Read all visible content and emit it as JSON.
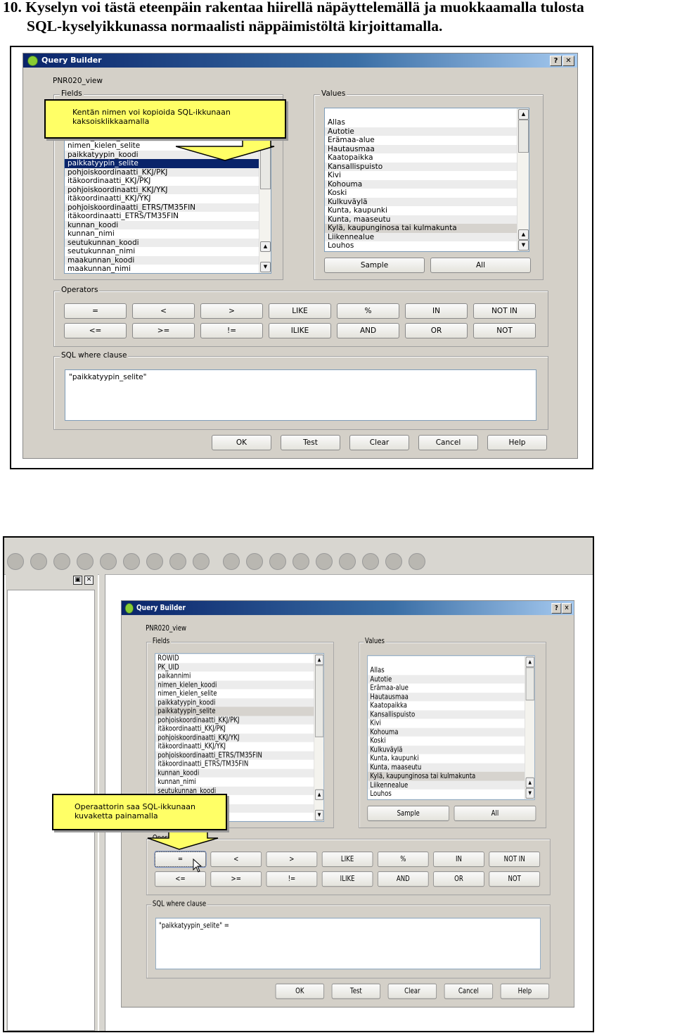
{
  "heading": {
    "line1": "10. Kyselyn voi tästä eteenpäin rakentaa hiirellä näpäyttelemällä ja muokkaamalla tulosta",
    "line2": "SQL-kyselyikkunassa normaalisti näppäimistöltä kirjoittamalla."
  },
  "dialog": {
    "title": "Query Builder",
    "help_btn": "?",
    "close_btn": "✕",
    "table_name": "PNR020_view",
    "fields_label": "Fields",
    "values_label": "Values",
    "operators_label": "Operators",
    "sql_label": "SQL where clause",
    "fields": [
      "ROWID",
      "PK_UID",
      "paikannimi",
      "nimen_kielen_koodi",
      "nimen_kielen_selite",
      "paikkatyypin_koodi",
      "paikkatyypin_selite",
      "pohjoiskoordinaatti_KKJ/PKJ",
      "itäkoordinaatti_KKJ/PKJ",
      "pohjoiskoordinaatti_KKJ/YKJ",
      "itäkoordinaatti_KKJ/YKJ",
      "pohjoiskoordinaatti_ETRS/TM35FIN",
      "itäkoordinaatti_ETRS/TM35FIN",
      "kunnan_koodi",
      "kunnan_nimi",
      "seutukunnan_koodi",
      "seutukunnan_nimi",
      "maakunnan_koodi",
      "maakunnan_nimi"
    ],
    "selected_field": "paikkatyypin_selite",
    "values": [
      "Allas",
      "Autotie",
      "Erämaa-alue",
      "Hautausmaa",
      "Kaatopaikka",
      "Kansallispuisto",
      "Kivi",
      "Kohouma",
      "Koski",
      "Kulkuväylä",
      "Kunta, kaupunki",
      "Kunta, maaseutu",
      "Kylä, kaupunginosa tai kulmakunta",
      "Liikennealue",
      "Louhos"
    ],
    "selected_value": "Kylä, kaupunginosa tai kulmakunta",
    "sample_btn": "Sample",
    "all_btn": "All",
    "operators": [
      [
        "=",
        "<",
        ">",
        "LIKE",
        "%",
        "IN",
        "NOT IN"
      ],
      [
        "<=",
        ">=",
        "!=",
        "ILIKE",
        "AND",
        "OR",
        "NOT"
      ]
    ],
    "buttons": [
      "OK",
      "Test",
      "Clear",
      "Cancel",
      "Help"
    ]
  },
  "screens": [
    {
      "sql": "\"paikkatyypin_selite\"",
      "callout": "Kentän  nimen  voi  kopioida  SQL-ikkunaan kaksoisklikkaamalla",
      "selection_color": "#0a246a"
    },
    {
      "sql": "\"paikkatyypin_selite\" =",
      "callout": "Operaattorin saa SQL-ikkunaan kuvaketta painamalla",
      "selection_color": "#d6d3ce"
    }
  ],
  "colors": {
    "callout": "#ffff66",
    "dialog_bg": "#d4d0c8",
    "titlebar": "#0a246a"
  }
}
